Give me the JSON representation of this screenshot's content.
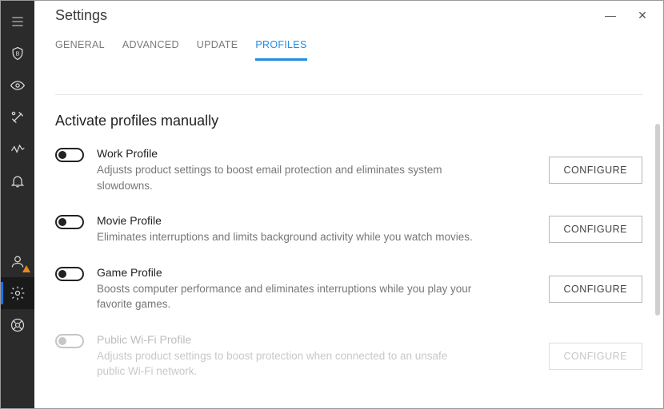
{
  "window": {
    "title": "Settings"
  },
  "tabs": {
    "general": "GENERAL",
    "advanced": "ADVANCED",
    "update": "UPDATE",
    "profiles": "PROFILES"
  },
  "section": {
    "heading": "Activate profiles manually"
  },
  "profiles": {
    "work": {
      "title": "Work Profile",
      "desc": "Adjusts product settings to boost email protection and eliminates system slowdowns.",
      "button": "CONFIGURE"
    },
    "movie": {
      "title": "Movie Profile",
      "desc": "Eliminates interruptions and limits background activity while you watch movies.",
      "button": "CONFIGURE"
    },
    "game": {
      "title": "Game Profile",
      "desc": "Boosts computer performance and eliminates interruptions while you play your favorite games.",
      "button": "CONFIGURE"
    },
    "wifi": {
      "title": "Public Wi-Fi Profile",
      "desc": "Adjusts product settings to boost protection when connected to an unsafe public Wi-Fi network.",
      "button": "CONFIGURE"
    }
  },
  "sidebar": {
    "items": [
      "menu",
      "protection",
      "privacy",
      "tools",
      "activity",
      "notifications",
      "account",
      "settings",
      "support"
    ]
  }
}
